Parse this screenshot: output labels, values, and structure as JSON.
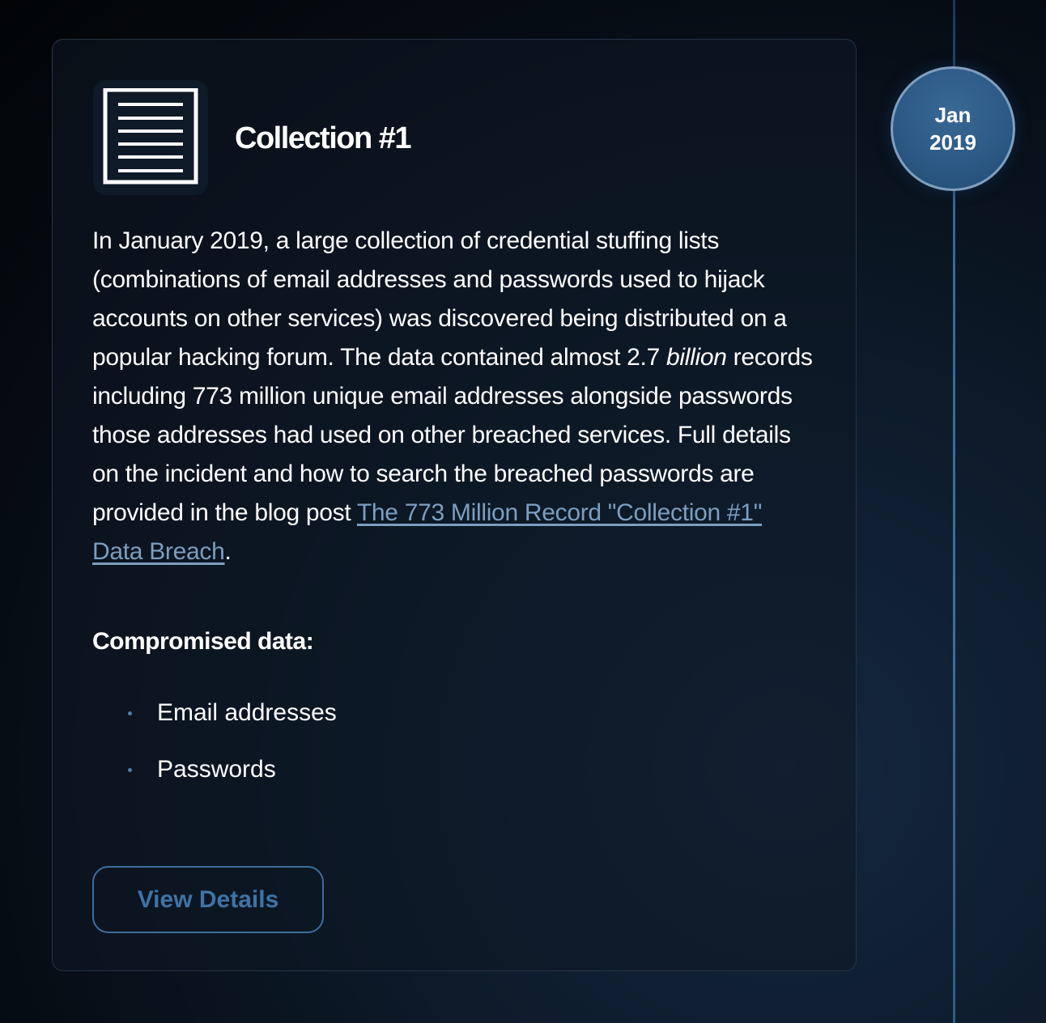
{
  "timeline": {
    "date_month": "Jan",
    "date_year": "2019"
  },
  "breach": {
    "logo_icon": "document-lines-icon",
    "title": "Collection #1",
    "description": {
      "part1": "In January 2019, a large collection of credential stuffing lists (combinations of email addresses and passwords used to hijack accounts on other services) was discovered being distributed on a popular hacking forum. The data contained almost 2.7 ",
      "emphasis": "billion",
      "part2": " records including 773 million unique email addresses alongside passwords those addresses had used on other breached services. Full details on the incident and how to search the breached passwords are provided in the blog post ",
      "link_text": "The 773 Million Record \"Collection #1\" Data Breach",
      "part3": "."
    },
    "compromised_heading": "Compromised data:",
    "compromised_items": [
      "Email addresses",
      "Passwords"
    ],
    "button_label": "View Details"
  },
  "colors": {
    "accent": "#3f6d9c",
    "link": "#7c9ec0",
    "badge_fill": "#2b5884",
    "badge_border": "#7f9fbf"
  }
}
